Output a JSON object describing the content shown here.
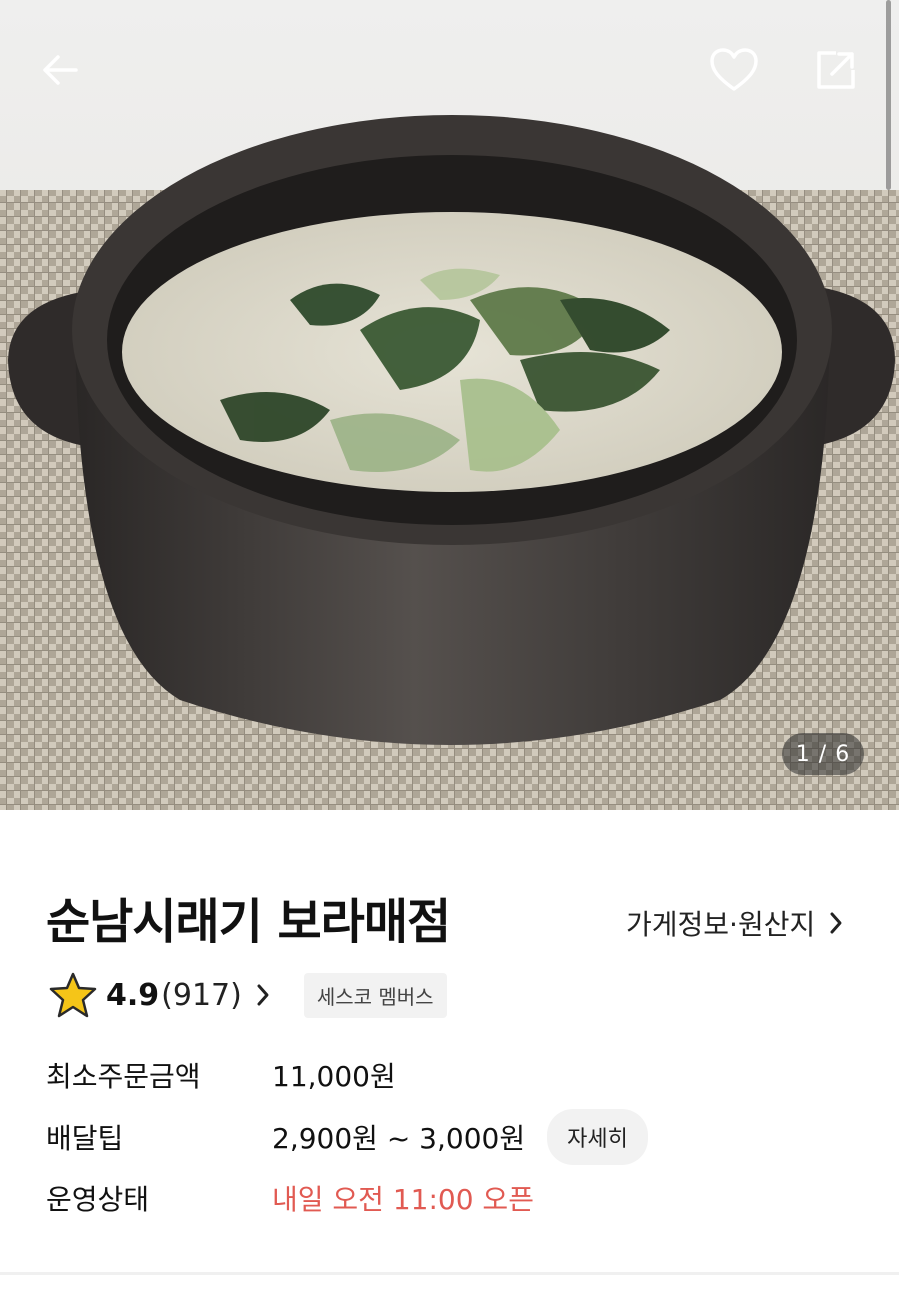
{
  "photo": {
    "alt": "Cream soup with greens in a black clay pot",
    "counter": "1 / 6"
  },
  "header": {
    "back_icon": "arrow-left-icon",
    "like_icon": "heart-outline-icon",
    "share_icon": "share-icon"
  },
  "store": {
    "name": "순남시래기 보라매점",
    "info_link": "가게정보·원산지",
    "rating": "4.9",
    "review_count": "(917)",
    "member_badge": "세스코 멤버스"
  },
  "details": [
    {
      "label": "최소주문금액",
      "value": "11,000원"
    },
    {
      "label": "배달팁",
      "value": "2,900원 ~ 3,000원",
      "button": "자세히"
    },
    {
      "label": "운영상태",
      "value": "내일 오전 11:00 오픈"
    }
  ],
  "colors": {
    "status_red": "#e15a52",
    "star": "#f5c518",
    "badge_bg": "#f2f2f2"
  }
}
